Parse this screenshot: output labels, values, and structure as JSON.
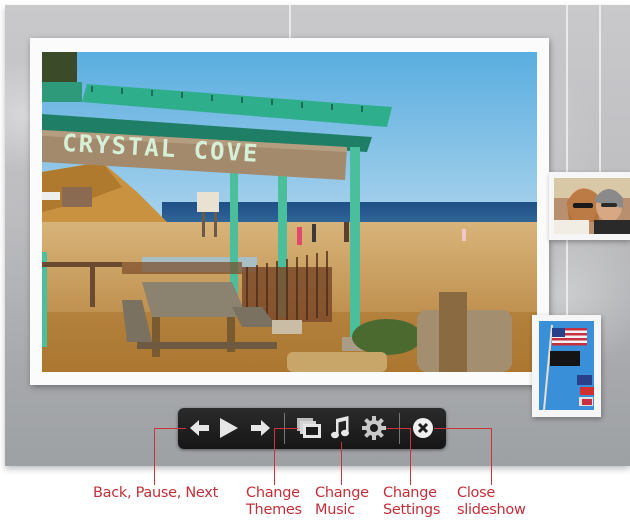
{
  "slideshow": {
    "main_photo": {
      "description": "Beach scene with green pergola and wooden sign",
      "sign_text": "CRYSTAL COVE"
    },
    "thumbnails": [
      {
        "description": "Two people smiling, selfie at sunset"
      },
      {
        "description": "American flag and pirate flag on pole against blue sky"
      }
    ]
  },
  "toolbar": {
    "buttons": [
      {
        "name": "back",
        "icon": "arrow-left-icon"
      },
      {
        "name": "play-pause",
        "icon": "play-icon"
      },
      {
        "name": "next",
        "icon": "arrow-right-icon"
      },
      {
        "name": "themes",
        "icon": "photo-stack-icon"
      },
      {
        "name": "music",
        "icon": "music-note-icon"
      },
      {
        "name": "settings",
        "icon": "gear-icon"
      },
      {
        "name": "close",
        "icon": "close-circle-icon"
      }
    ]
  },
  "callouts": {
    "nav": "Back, Pause, Next",
    "themes": "Change\nThemes",
    "music": "Change\nMusic",
    "settings": "Change\nSettings",
    "close": "Close\nslideshow"
  },
  "colors": {
    "callout": "#c0303a",
    "toolbar_bg": "#1e1e1e",
    "icon": "#e6e6e6"
  }
}
